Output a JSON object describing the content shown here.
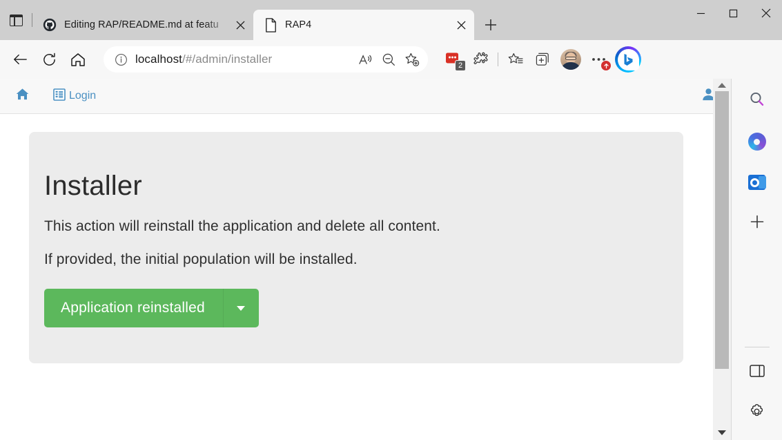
{
  "browser": {
    "tab_actions_tooltip": "Tab actions",
    "tabs": [
      {
        "title": "Editing RAP/README.md at featu",
        "favicon": "github-icon",
        "active": false
      },
      {
        "title": "RAP4",
        "favicon": "document-icon",
        "active": true
      }
    ],
    "new_tab_label": "+",
    "window_controls": {
      "minimize": "—",
      "maximize": "□",
      "close": "✕"
    },
    "nav": {
      "back": "back-arrow",
      "refresh": "refresh-icon",
      "home": "home-icon"
    },
    "omnibox": {
      "site_info_icon": "info-icon",
      "url_prefix": "localhost",
      "url_suffix": "/#/admin/installer",
      "full_url": "localhost/#/admin/installer",
      "read_aloud_icon": "read-aloud-icon",
      "zoom_icon": "zoom-out-icon",
      "favorite_icon": "add-favorite-icon"
    },
    "toolbar": {
      "items": [
        {
          "name": "split-screen-notification-icon",
          "badge": "2"
        },
        {
          "name": "extensions-icon",
          "badge": ""
        },
        {
          "name": "favorites-icon",
          "badge": ""
        },
        {
          "name": "collections-icon",
          "badge": ""
        },
        {
          "name": "profile-avatar",
          "badge": ""
        },
        {
          "name": "settings-more-icon",
          "badge": "update"
        },
        {
          "name": "bing-copilot-icon",
          "badge": ""
        }
      ]
    }
  },
  "page": {
    "nav": {
      "home_icon": "home-icon",
      "login_icon": "login-form-icon",
      "login_label": "Login",
      "user_icon": "user-account-icon"
    },
    "card": {
      "title": "Installer",
      "line1": "This action will reinstall the application and delete all content.",
      "line2": "If provided, the initial population will be installed.",
      "button_label": "Application reinstalled",
      "button_color": "#5cb85c",
      "caret": "chevron-down-icon"
    },
    "scrollbar": {
      "up": "▲",
      "down": "▼"
    }
  },
  "sidebar": {
    "items": [
      {
        "name": "search-icon"
      },
      {
        "name": "microsoft-365-icon"
      },
      {
        "name": "outlook-icon"
      },
      {
        "name": "add-sidebar-app-icon"
      }
    ],
    "bottom_items": [
      {
        "name": "sidebar-toggle-icon"
      },
      {
        "name": "sidebar-settings-icon"
      }
    ]
  },
  "colors": {
    "accent_blue": "#4a90c2",
    "button_green": "#5cb85c",
    "card_bg": "#ececec",
    "chrome_bg": "#cfcfcf"
  }
}
